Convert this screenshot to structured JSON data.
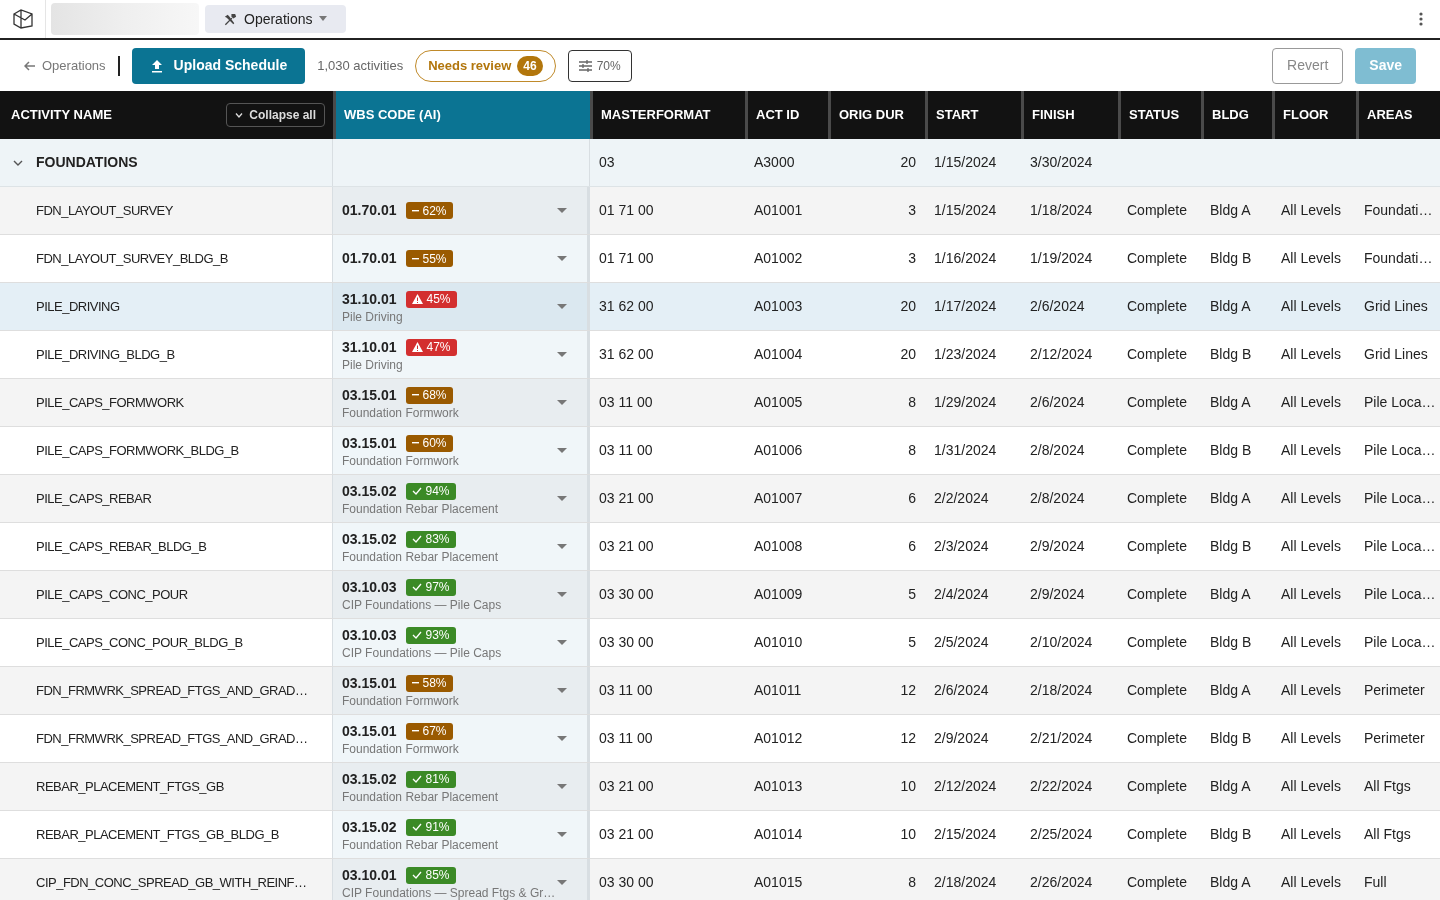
{
  "top_bar": {
    "workspace_menu": {
      "label": "Operations"
    }
  },
  "toolbar": {
    "back_link": "Operations",
    "upload_button": "Upload Schedule",
    "activity_count": "1,030 activities",
    "needs_review": {
      "label": "Needs review",
      "count": "46"
    },
    "threshold_button": "70%",
    "revert_button": "Revert",
    "save_button": {
      "label": "Save",
      "disabled": true
    }
  },
  "table": {
    "columns": [
      {
        "label": "ACTIVITY NAME",
        "highlighted": false
      },
      {
        "label": "WBS CODE (AI)",
        "highlighted": true
      },
      {
        "label": "MASTERFORMAT",
        "highlighted": false
      },
      {
        "label": "ACT ID",
        "highlighted": false
      },
      {
        "label": "ORIG DUR",
        "highlighted": false
      },
      {
        "label": "START",
        "highlighted": false
      },
      {
        "label": "FINISH",
        "highlighted": false
      },
      {
        "label": "STATUS",
        "highlighted": false
      },
      {
        "label": "BLDG",
        "highlighted": false
      },
      {
        "label": "FLOOR",
        "highlighted": false
      },
      {
        "label": "AREAS",
        "highlighted": false
      }
    ],
    "collapse_button": "Collapse all",
    "group": {
      "name": "FOUNDATIONS",
      "expanded": true,
      "masterformat": "03",
      "act_id": "A3000",
      "orig_dur": "20",
      "start": "1/15/2024",
      "finish": "3/30/2024"
    },
    "rows": [
      {
        "name": "FDN_LAYOUT_SURVEY",
        "selected": false,
        "wbs": "01.70.01",
        "confidence": {
          "kind": "medium",
          "value": "62%"
        },
        "wbs_desc": null,
        "masterformat": "01 71 00",
        "act_id": "A01001",
        "orig_dur": "3",
        "start": "1/15/2024",
        "finish": "1/18/2024",
        "status": "Complete",
        "bldg": "Bldg A",
        "floor": "All Levels",
        "areas": "Foundati…"
      },
      {
        "name": "FDN_LAYOUT_SURVEY_BLDG_B",
        "selected": false,
        "wbs": "01.70.01",
        "confidence": {
          "kind": "medium",
          "value": "55%"
        },
        "wbs_desc": null,
        "masterformat": "01 71 00",
        "act_id": "A01002",
        "orig_dur": "3",
        "start": "1/16/2024",
        "finish": "1/19/2024",
        "status": "Complete",
        "bldg": "Bldg B",
        "floor": "All Levels",
        "areas": "Foundati…"
      },
      {
        "name": "PILE_DRIVING",
        "selected": true,
        "wbs": "31.10.01",
        "confidence": {
          "kind": "low",
          "value": "45%"
        },
        "wbs_desc": "Pile Driving",
        "masterformat": "31 62 00",
        "act_id": "A01003",
        "orig_dur": "20",
        "start": "1/17/2024",
        "finish": "2/6/2024",
        "status": "Complete",
        "bldg": "Bldg A",
        "floor": "All Levels",
        "areas": "Grid Lines"
      },
      {
        "name": "PILE_DRIVING_BLDG_B",
        "selected": false,
        "wbs": "31.10.01",
        "confidence": {
          "kind": "low",
          "value": "47%"
        },
        "wbs_desc": "Pile Driving",
        "masterformat": "31 62 00",
        "act_id": "A01004",
        "orig_dur": "20",
        "start": "1/23/2024",
        "finish": "2/12/2024",
        "status": "Complete",
        "bldg": "Bldg B",
        "floor": "All Levels",
        "areas": "Grid Lines"
      },
      {
        "name": "PILE_CAPS_FORMWORK",
        "selected": false,
        "wbs": "03.15.01",
        "confidence": {
          "kind": "medium",
          "value": "68%"
        },
        "wbs_desc": "Foundation Formwork",
        "masterformat": "03 11 00",
        "act_id": "A01005",
        "orig_dur": "8",
        "start": "1/29/2024",
        "finish": "2/6/2024",
        "status": "Complete",
        "bldg": "Bldg A",
        "floor": "All Levels",
        "areas": "Pile Loca…"
      },
      {
        "name": "PILE_CAPS_FORMWORK_BLDG_B",
        "selected": false,
        "wbs": "03.15.01",
        "confidence": {
          "kind": "medium",
          "value": "60%"
        },
        "wbs_desc": "Foundation Formwork",
        "masterformat": "03 11 00",
        "act_id": "A01006",
        "orig_dur": "8",
        "start": "1/31/2024",
        "finish": "2/8/2024",
        "status": "Complete",
        "bldg": "Bldg B",
        "floor": "All Levels",
        "areas": "Pile Loca…"
      },
      {
        "name": "PILE_CAPS_REBAR",
        "selected": false,
        "wbs": "03.15.02",
        "confidence": {
          "kind": "high",
          "value": "94%"
        },
        "wbs_desc": "Foundation Rebar Placement",
        "masterformat": "03 21 00",
        "act_id": "A01007",
        "orig_dur": "6",
        "start": "2/2/2024",
        "finish": "2/8/2024",
        "status": "Complete",
        "bldg": "Bldg A",
        "floor": "All Levels",
        "areas": "Pile Loca…"
      },
      {
        "name": "PILE_CAPS_REBAR_BLDG_B",
        "selected": false,
        "wbs": "03.15.02",
        "confidence": {
          "kind": "high",
          "value": "83%"
        },
        "wbs_desc": "Foundation Rebar Placement",
        "masterformat": "03 21 00",
        "act_id": "A01008",
        "orig_dur": "6",
        "start": "2/3/2024",
        "finish": "2/9/2024",
        "status": "Complete",
        "bldg": "Bldg B",
        "floor": "All Levels",
        "areas": "Pile Loca…"
      },
      {
        "name": "PILE_CAPS_CONC_POUR",
        "selected": false,
        "wbs": "03.10.03",
        "confidence": {
          "kind": "high",
          "value": "97%"
        },
        "wbs_desc": "CIP Foundations — Pile Caps",
        "masterformat": "03 30 00",
        "act_id": "A01009",
        "orig_dur": "5",
        "start": "2/4/2024",
        "finish": "2/9/2024",
        "status": "Complete",
        "bldg": "Bldg A",
        "floor": "All Levels",
        "areas": "Pile Loca…"
      },
      {
        "name": "PILE_CAPS_CONC_POUR_BLDG_B",
        "selected": false,
        "wbs": "03.10.03",
        "confidence": {
          "kind": "high",
          "value": "93%"
        },
        "wbs_desc": "CIP Foundations — Pile Caps",
        "masterformat": "03 30 00",
        "act_id": "A01010",
        "orig_dur": "5",
        "start": "2/5/2024",
        "finish": "2/10/2024",
        "status": "Complete",
        "bldg": "Bldg B",
        "floor": "All Levels",
        "areas": "Pile Loca…"
      },
      {
        "name": "FDN_FRMWRK_SPREAD_FTGS_AND_GRAD…",
        "selected": false,
        "wbs": "03.15.01",
        "confidence": {
          "kind": "medium",
          "value": "58%"
        },
        "wbs_desc": "Foundation Formwork",
        "masterformat": "03 11 00",
        "act_id": "A01011",
        "orig_dur": "12",
        "start": "2/6/2024",
        "finish": "2/18/2024",
        "status": "Complete",
        "bldg": "Bldg A",
        "floor": "All Levels",
        "areas": "Perimeter"
      },
      {
        "name": "FDN_FRMWRK_SPREAD_FTGS_AND_GRAD…",
        "selected": false,
        "wbs": "03.15.01",
        "confidence": {
          "kind": "medium",
          "value": "67%"
        },
        "wbs_desc": "Foundation Formwork",
        "masterformat": "03 11 00",
        "act_id": "A01012",
        "orig_dur": "12",
        "start": "2/9/2024",
        "finish": "2/21/2024",
        "status": "Complete",
        "bldg": "Bldg B",
        "floor": "All Levels",
        "areas": "Perimeter"
      },
      {
        "name": "REBAR_PLACEMENT_FTGS_GB",
        "selected": false,
        "wbs": "03.15.02",
        "confidence": {
          "kind": "high",
          "value": "81%"
        },
        "wbs_desc": "Foundation Rebar Placement",
        "masterformat": "03 21 00",
        "act_id": "A01013",
        "orig_dur": "10",
        "start": "2/12/2024",
        "finish": "2/22/2024",
        "status": "Complete",
        "bldg": "Bldg A",
        "floor": "All Levels",
        "areas": "All Ftgs"
      },
      {
        "name": "REBAR_PLACEMENT_FTGS_GB_BLDG_B",
        "selected": false,
        "wbs": "03.15.02",
        "confidence": {
          "kind": "high",
          "value": "91%"
        },
        "wbs_desc": "Foundation Rebar Placement",
        "masterformat": "03 21 00",
        "act_id": "A01014",
        "orig_dur": "10",
        "start": "2/15/2024",
        "finish": "2/25/2024",
        "status": "Complete",
        "bldg": "Bldg B",
        "floor": "All Levels",
        "areas": "All Ftgs"
      },
      {
        "name": "CIP_FDN_CONC_SPREAD_GB_WITH_REINF…",
        "selected": false,
        "wbs": "03.10.01",
        "confidence": {
          "kind": "high",
          "value": "85%"
        },
        "wbs_desc": "CIP Foundations — Spread Ftgs & Gr…",
        "masterformat": "03 30 00",
        "act_id": "A01015",
        "orig_dur": "8",
        "start": "2/18/2024",
        "finish": "2/26/2024",
        "status": "Complete",
        "bldg": "Bldg A",
        "floor": "All Levels",
        "areas": "Full"
      }
    ]
  }
}
